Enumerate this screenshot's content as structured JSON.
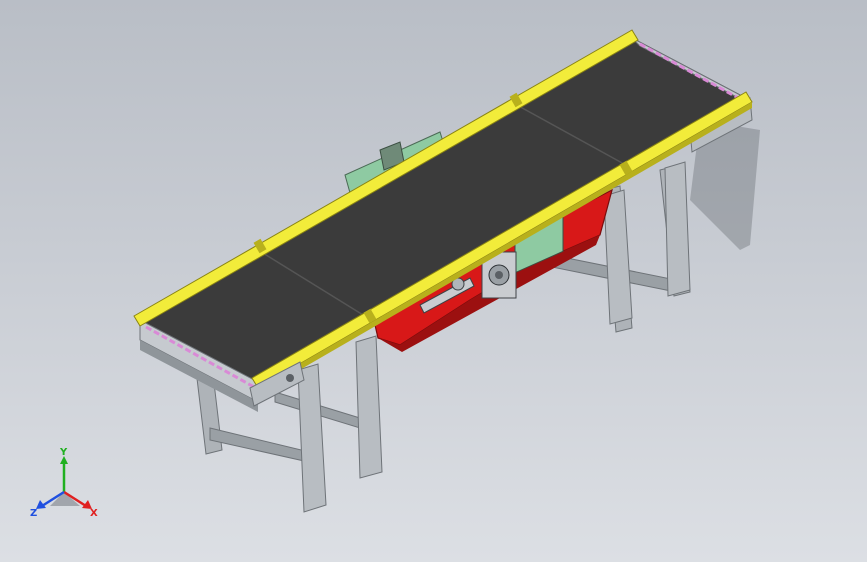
{
  "viewport": {
    "model": "belt-conveyor",
    "view": "isometric",
    "background_top": "#b9bec6",
    "background_bottom": "#dcdfe4"
  },
  "colors": {
    "belt": "#3b3b3b",
    "belt_edge": "#2a2a2a",
    "side_rail": "#f2ec3a",
    "side_rail_shadow": "#b8b01c",
    "drive_housing": "#d81818",
    "drive_housing_dark": "#9c1010",
    "access_panel": "#8ecaa2",
    "frame": "#aeb3b8",
    "frame_dark": "#7e8489",
    "roller_marker": "#d98ad6"
  },
  "triad": {
    "icons": [
      "axis-x-icon",
      "axis-y-icon",
      "axis-z-icon"
    ],
    "x_label": "X",
    "y_label": "Y",
    "z_label": "Z",
    "x_color": "#e02020",
    "y_color": "#20b020",
    "z_color": "#2050e0"
  }
}
